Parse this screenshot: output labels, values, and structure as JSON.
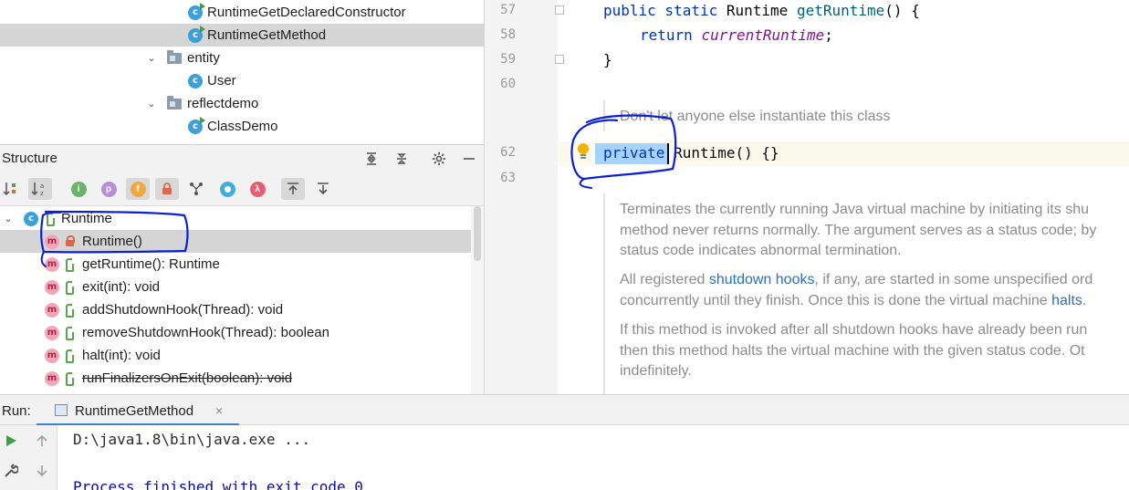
{
  "project_tree": {
    "items": [
      {
        "label": "RuntimeGetDeclaredConstructor",
        "type": "class"
      },
      {
        "label": "RuntimeGetMethod",
        "type": "class",
        "selected": true
      },
      {
        "label": "entity",
        "type": "package"
      },
      {
        "label": "User",
        "type": "class"
      },
      {
        "label": "reflectdemo",
        "type": "package"
      },
      {
        "label": "ClassDemo",
        "type": "class"
      }
    ],
    "class_icon_letter": "c"
  },
  "structure": {
    "title": "Structure",
    "root": {
      "label": "Runtime",
      "icon_letter": "c"
    },
    "members": [
      {
        "label": "Runtime()",
        "visibility": "private",
        "selected": true
      },
      {
        "label": "getRuntime(): Runtime",
        "visibility": "public"
      },
      {
        "label": "exit(int): void",
        "visibility": "public"
      },
      {
        "label": "addShutdownHook(Thread): void",
        "visibility": "public"
      },
      {
        "label": "removeShutdownHook(Thread): boolean",
        "visibility": "public"
      },
      {
        "label": "halt(int): void",
        "visibility": "public"
      },
      {
        "label": "runFinalizersOnExit(boolean): void",
        "visibility": "public",
        "deprecated": true
      }
    ],
    "method_icon_letter": "m",
    "toolbar": {
      "inherited": "i",
      "properties": "p",
      "fields": "f",
      "lambda": "λ"
    }
  },
  "editor": {
    "line_numbers": [
      "57",
      "58",
      "59",
      "60",
      "62",
      "63"
    ],
    "code": {
      "l57_kw": "public static",
      "l57_type": " Runtime ",
      "l57_fn": "getRuntime",
      "l57_end": "() {",
      "l58_kw": "return",
      "l58_fld": "currentRuntime",
      "l58_end": ";",
      "l59": "}",
      "l62_kw": "private",
      "l62_rest": " Runtime() {}"
    },
    "doc_comment_1": "Don't let anyone else instantiate this class",
    "doc_comment_2": {
      "p1_l1": "Terminates the currently running Java virtual machine by initiating its shu",
      "p1_l2": "method never returns normally. The argument serves as a status code; by",
      "p1_l3": "status code indicates abnormal termination.",
      "p2_l1_a": "All registered ",
      "p2_l1_link": "shutdown hooks",
      "p2_l1_b": ", if any, are started in some unspecified ord",
      "p2_l2_a": "concurrently until they finish. Once this is done the virtual machine ",
      "p2_l2_link": "halts",
      "p2_l2_b": ".",
      "p3_l1": "If this method is invoked after all shutdown hooks have already been run",
      "p3_l2": "then this method halts the virtual machine with the given status code. Ot",
      "p3_l3": "indefinitely."
    }
  },
  "run": {
    "title": "Run:",
    "tab_label": "RuntimeGetMethod",
    "tab_close": "×",
    "console": [
      "D:\\java1.8\\bin\\java.exe ...",
      "",
      "Process finished with exit code 0"
    ]
  },
  "colors": {
    "annotation_ink": "#0a1fd6",
    "selection": "#a6d2ff",
    "class_icon": "#3d9fd8",
    "method_icon": "#f3a6b6",
    "run_green": "#3ba341"
  }
}
